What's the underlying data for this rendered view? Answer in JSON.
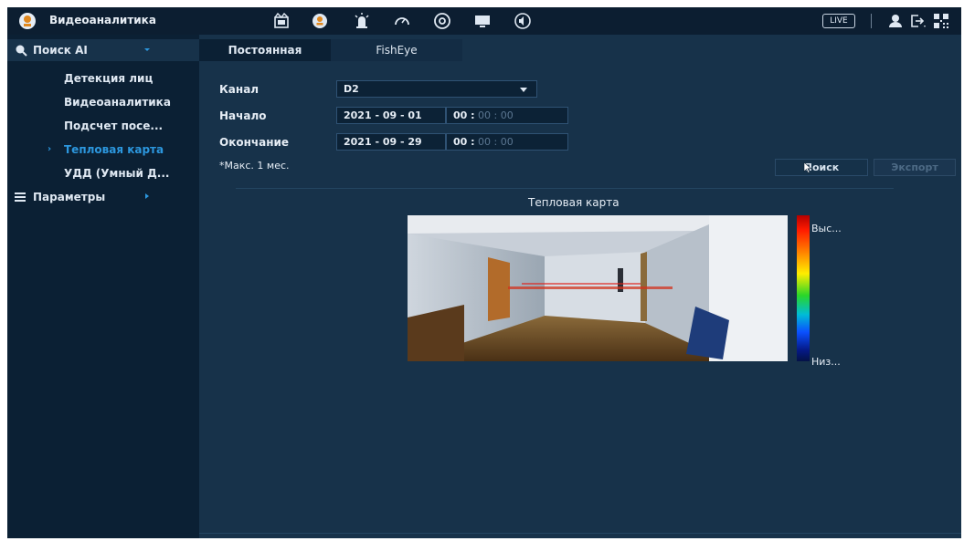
{
  "app": {
    "title": "Видеоаналитика",
    "live_label": "LIVE"
  },
  "toolbar_icons": [
    "playback-icon",
    "face-ai-icon",
    "alarm-icon",
    "gauge-icon",
    "disc-icon",
    "monitor-icon",
    "speaker-icon",
    "user-icon",
    "logout-icon",
    "qr-icon"
  ],
  "sidebar": {
    "search_ai": "Поиск AI",
    "items": [
      {
        "label": "Детекция лиц",
        "active": false
      },
      {
        "label": "Видеоаналитика",
        "active": false
      },
      {
        "label": "Подсчет посе...",
        "active": false
      },
      {
        "label": "Тепловая карта",
        "active": true
      },
      {
        "label": "УДД (Умный Д...",
        "active": false
      }
    ],
    "params": "Параметры"
  },
  "tabs": [
    {
      "label": "Постоянная",
      "active": true
    },
    {
      "label": "FishEye",
      "active": false
    }
  ],
  "form": {
    "channel_label": "Канал",
    "channel_value": "D2",
    "start_label": "Начало",
    "start_date": "2021 - 09 - 01",
    "start_time_hh": "00 :",
    "start_time_rest": " 00 : 00",
    "end_label": "Окончание",
    "end_date": "2021 - 09 - 29",
    "end_time_hh": "00 :",
    "end_time_rest": " 00 : 00",
    "note": "*Макс. 1 мес."
  },
  "buttons": {
    "search": "Поиск",
    "export": "Экспорт"
  },
  "heatmap": {
    "title": "Тепловая карта",
    "high_label": "Выс...",
    "low_label": "Низ..."
  },
  "colors": {
    "accent": "#2c97de",
    "panel": "#17324a",
    "sidebar": "#0b2034",
    "topbar": "#0c1e31"
  }
}
